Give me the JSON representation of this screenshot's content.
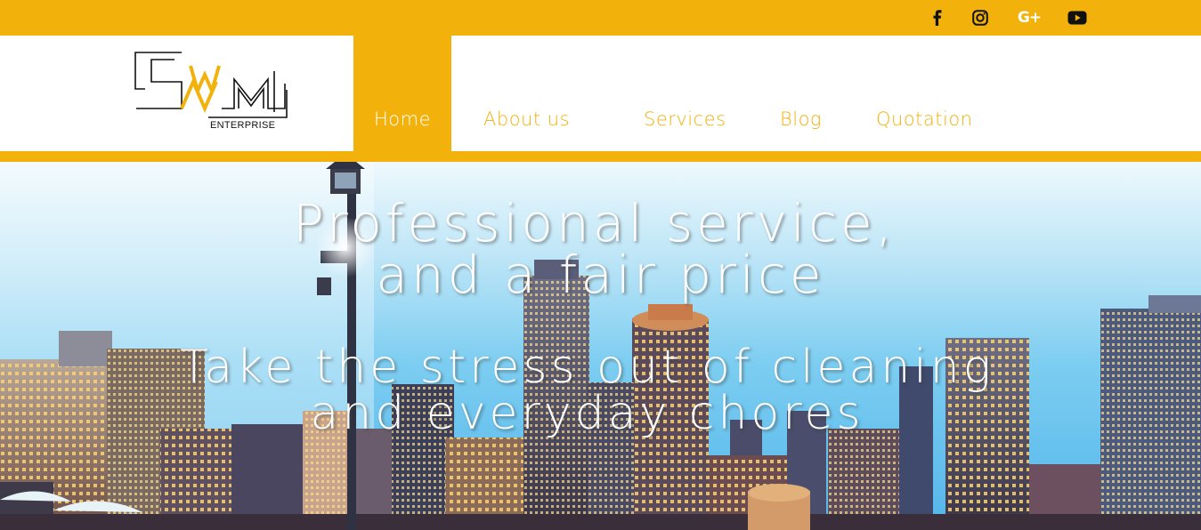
{
  "topbar": {
    "accent": "#f3b20b",
    "social": [
      {
        "name": "facebook-icon",
        "glyph": "f"
      },
      {
        "name": "instagram-icon",
        "glyph": ""
      },
      {
        "name": "google-plus-icon",
        "glyph": "G+"
      },
      {
        "name": "youtube-icon",
        "glyph": ""
      }
    ]
  },
  "logo": {
    "text": "ENTERPRISE"
  },
  "nav": {
    "items": [
      {
        "label": "Home",
        "active": true
      },
      {
        "label": "About us",
        "active": false
      },
      {
        "label": "Services",
        "active": false
      },
      {
        "label": "Blog",
        "active": false
      },
      {
        "label": "Quotation",
        "active": false
      }
    ]
  },
  "hero": {
    "headline_line1": "Professional service,",
    "headline_line2": "and a fair price",
    "subline_line1": "Take the stress out of cleaning",
    "subline_line2": "and everyday chores"
  }
}
